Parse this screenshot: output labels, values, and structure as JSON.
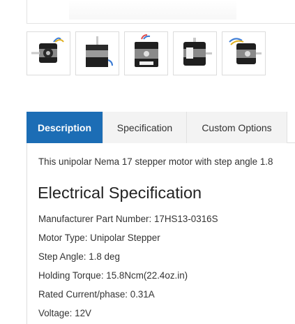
{
  "gallery": {
    "thumbnails": [
      {
        "icon": "stepper-motor-front-view"
      },
      {
        "icon": "stepper-motor-shaft-up-view"
      },
      {
        "icon": "stepper-motor-connector-view"
      },
      {
        "icon": "stepper-motor-side-view"
      },
      {
        "icon": "stepper-motor-angled-view"
      }
    ]
  },
  "tabs": [
    {
      "label": "Description",
      "active": true
    },
    {
      "label": "Specification",
      "active": false
    },
    {
      "label": "Custom Options",
      "active": false
    }
  ],
  "description": {
    "intro": "This unipolar Nema 17 stepper motor with step angle 1.8",
    "heading": "Electrical Specification",
    "specs": [
      "Manufacturer Part Number: 17HS13-0316S",
      "Motor Type: Unipolar Stepper",
      "Step Angle: 1.8 deg",
      "Holding Torque: 15.8Ncm(22.4oz.in)",
      "Rated Current/phase: 0.31A",
      "Voltage: 12V"
    ]
  },
  "colors": {
    "active_tab": "#1c6db5",
    "tab_background": "#f3f3f3"
  }
}
